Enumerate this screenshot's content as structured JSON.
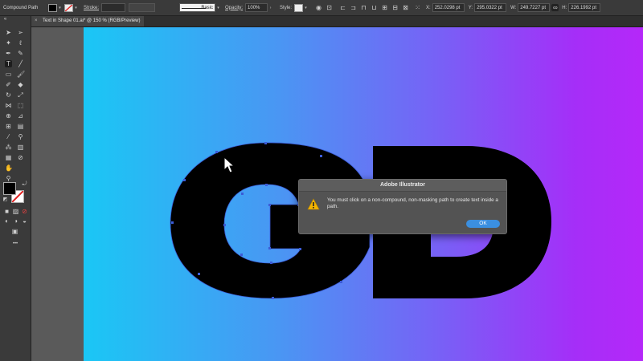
{
  "control_bar": {
    "selection_type": "Compound Path",
    "stroke_label": "Stroke:",
    "brush_label": "Basic",
    "opacity_label": "Opacity:",
    "opacity_value": "100%",
    "style_label": "Style:",
    "x_label": "X:",
    "x_value": "252.0298 pt",
    "y_label": "Y:",
    "y_value": "295.0322 pt",
    "w_label": "W:",
    "w_value": "249.7227 pt",
    "h_label": "H:",
    "h_value": "226.1992 pt"
  },
  "document_tab": {
    "close": "×",
    "title": "Text in Shape 01.ai* @ 150 % (RGB/Preview)"
  },
  "toolbar": {
    "more": "•••"
  },
  "artwork": {
    "text": "GD",
    "gradient_colors": [
      "#1ac7f5",
      "#7a5ef6",
      "#b528f9"
    ],
    "fill": "#000000",
    "selection_color": "#3b5bd6"
  },
  "dialog": {
    "title": "Adobe Illustrator",
    "message": "You must click on a non-compound, non-masking path to create text inside a path.",
    "ok_label": "OK",
    "icon": "warning-icon"
  }
}
